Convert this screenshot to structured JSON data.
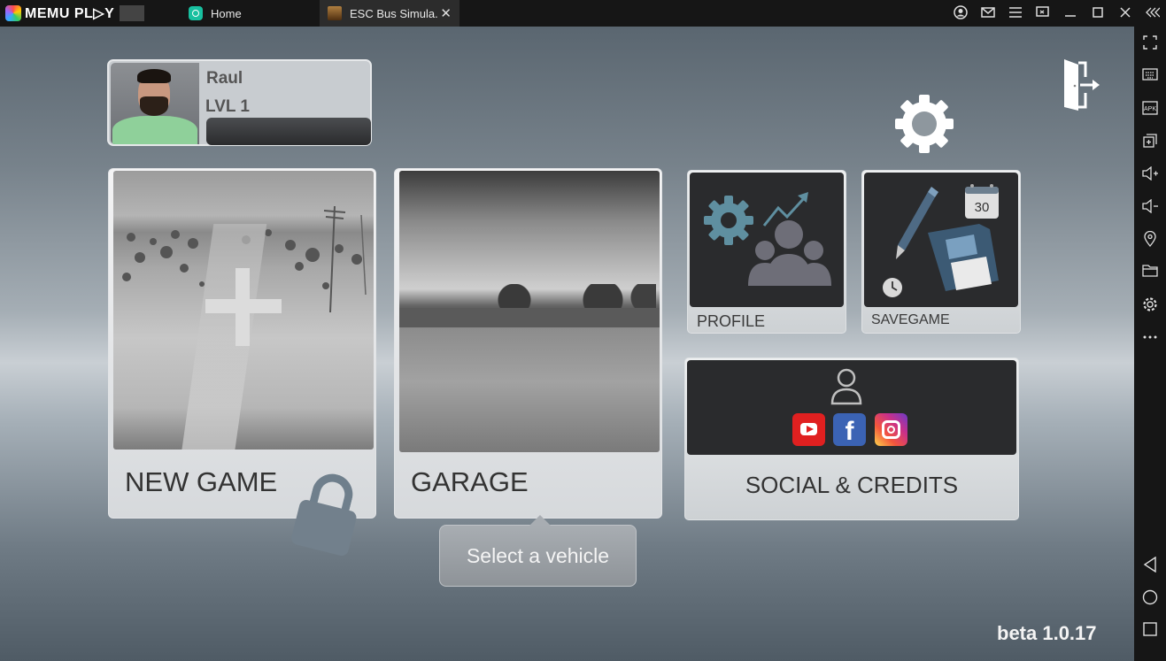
{
  "emulator": {
    "brand": "MEMU PL▷Y",
    "tabs": [
      {
        "label": "Home"
      },
      {
        "label": "ESC Bus Simula.",
        "close": "✕"
      }
    ],
    "window_controls": [
      "account-icon",
      "mail-icon",
      "menu-icon",
      "screen-cast-icon",
      "minimize-icon",
      "maximize-icon",
      "close-icon",
      "collapse-icon"
    ],
    "toolbar": [
      "fullscreen-icon",
      "keyboard-icon",
      "apk-icon",
      "add-window-icon",
      "volume-up-icon",
      "volume-down-icon",
      "location-icon",
      "folder-icon",
      "settings-icon",
      "more-icon",
      "back-icon",
      "home-icon",
      "recents-icon"
    ],
    "apk_label": "APK"
  },
  "player": {
    "name": "Raul",
    "level": "LVL 1",
    "xp_progress": 0
  },
  "menu": {
    "new_game": "NEW GAME",
    "garage": "GARAGE",
    "profile": "PROFILE",
    "savegame": "SAVEGAME",
    "calendar_day": "30",
    "social": "SOCIAL & CREDITS",
    "facebook_glyph": "f"
  },
  "tooltip": "Select a vehicle",
  "version": "beta 1.0.17",
  "colors": {
    "gear_accent": "#5f8fa0",
    "youtube": "#e02020",
    "facebook": "#3b63b4",
    "card_dark": "#2a2b2d"
  }
}
